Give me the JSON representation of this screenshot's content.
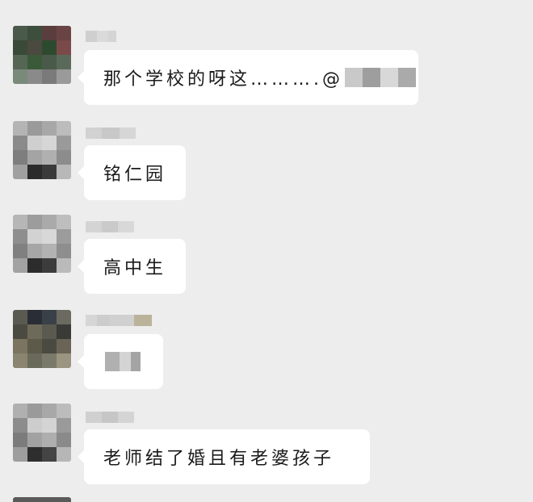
{
  "chat": {
    "messages": [
      {
        "text": "那个学校的呀",
        "extra_text": "这……….@"
      },
      {
        "text": "铭仁园"
      },
      {
        "text": "高中生"
      },
      {
        "text": ""
      },
      {
        "text": "老师结了婚且有老婆孩子"
      }
    ]
  },
  "colors": {
    "background": "#ededed",
    "bubble": "#ffffff",
    "text": "#1a1a1a"
  },
  "icons": {
    "avatar": "pixelated-avatar",
    "redaction": "mosaic-blur"
  }
}
